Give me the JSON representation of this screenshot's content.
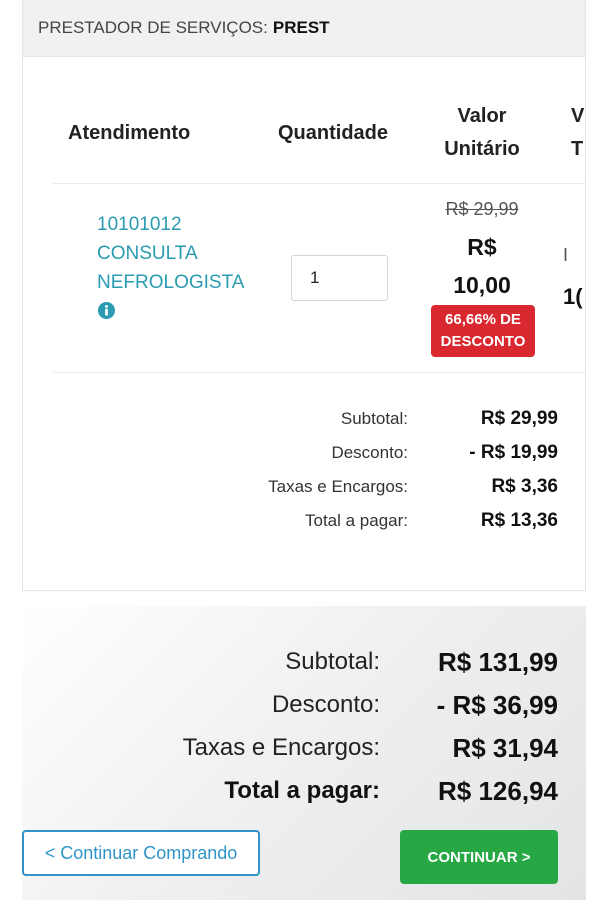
{
  "provider": {
    "label": "PRESTADOR DE SERVIÇOS:",
    "name": "PREST"
  },
  "table": {
    "headers": {
      "atendimento": "Atendimento",
      "quantidade": "Quantidade",
      "valor_unitario_line1": "Valor",
      "valor_unitario_line2": "Unitário",
      "valor_total_cut_line1": "V",
      "valor_total_cut_line2": "T"
    },
    "item": {
      "code": "10101012",
      "name_line1": "CONSULTA",
      "name_line2": "NEFROLOGISTA",
      "quantity": "1",
      "price_old": "R$ 29,99",
      "price_new_line1": "R$",
      "price_new_line2": "10,00",
      "discount_line1": "66,66% DE",
      "discount_line2": "DESCONTO",
      "total_cut_line1": "I",
      "total_cut_line2": "1("
    }
  },
  "item_summary": [
    {
      "label": "Subtotal:",
      "value": "R$ 29,99"
    },
    {
      "label": "Desconto:",
      "value": "- R$ 19,99"
    },
    {
      "label": "Taxas e Encargos:",
      "value": "R$ 3,36"
    },
    {
      "label": "Total a pagar:",
      "value": "R$ 13,36"
    }
  ],
  "order_totals": [
    {
      "label": "Subtotal:",
      "value": "R$ 131,99"
    },
    {
      "label": "Desconto:",
      "value": "- R$ 36,99"
    },
    {
      "label": "Taxas e Encargos:",
      "value": "R$ 31,94"
    },
    {
      "label": "Total a pagar:",
      "value": "R$ 126,94"
    }
  ],
  "buttons": {
    "back": "< Continuar Comprando",
    "continue": "CONTINUAR >"
  },
  "colors": {
    "link": "#2a9bb0",
    "discount_badge": "#d9282f",
    "continue_button": "#28a745",
    "back_button": "#2f95c9",
    "info_icon": "#2a9bb0"
  },
  "icons": {
    "info": "info-circle-icon"
  }
}
